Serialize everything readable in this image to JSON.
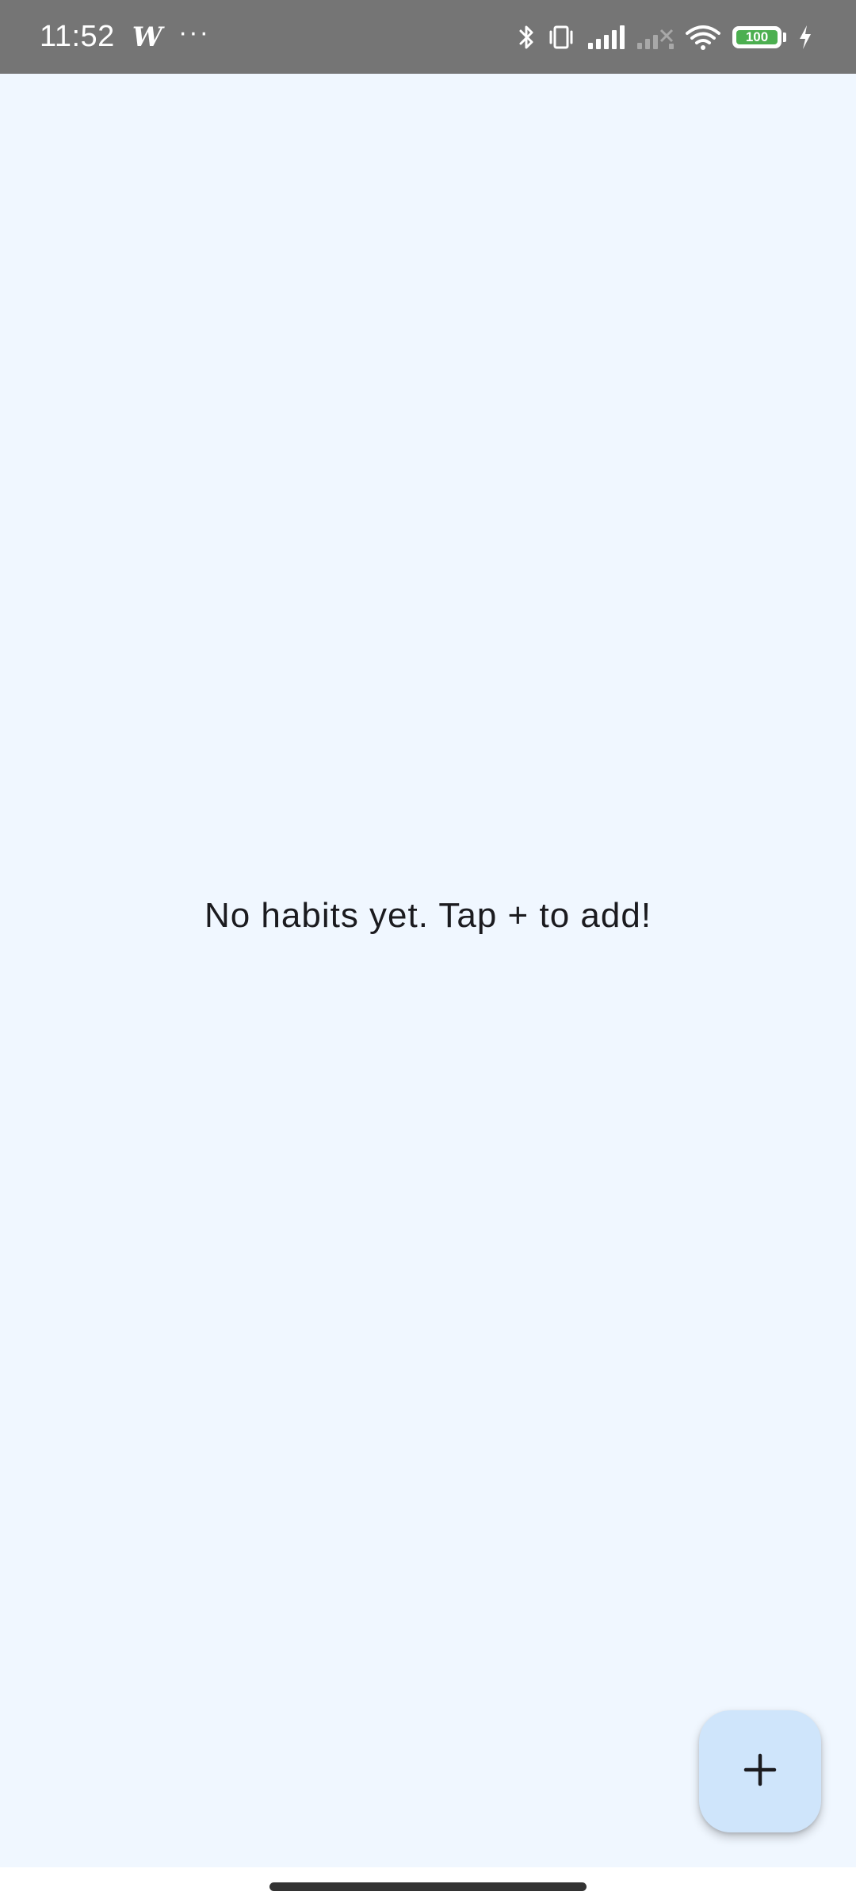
{
  "status_bar": {
    "time": "11:52",
    "app_notification_icon": "W",
    "more_notifications": "···",
    "battery_level": "100",
    "icons": [
      "bluetooth-icon",
      "vibrate-icon",
      "signal-icon",
      "signal-no-service-icon",
      "wifi-icon",
      "battery-icon",
      "charging-icon"
    ]
  },
  "main": {
    "empty_message": "No habits yet. Tap + to add!"
  },
  "fab": {
    "icon": "plus-icon"
  },
  "colors": {
    "background": "#f0f7ff",
    "status_bar": "#757575",
    "fab": "#cfe5fb",
    "battery": "#4caf50"
  }
}
